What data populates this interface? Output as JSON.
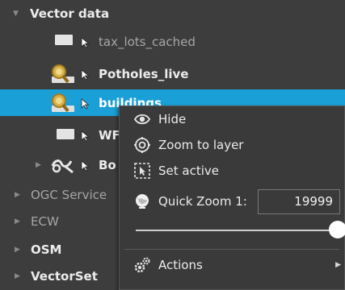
{
  "tree": {
    "items": [
      {
        "label": "Vector data",
        "expander": "expanded",
        "icon": "folder"
      },
      {
        "label": "tax_lots_cached",
        "icon": "raster-layer-icon",
        "state": "dim"
      },
      {
        "label": "Potholes_live",
        "icon": "search-layer-icon",
        "state": "bold"
      },
      {
        "label": "buildings",
        "icon": "search-layer-icon",
        "state": "selected"
      },
      {
        "label": "WF",
        "icon": "raster-layer-icon",
        "state": "bold"
      },
      {
        "label": "Bo",
        "icon": "vector-group-icon",
        "state": "bold",
        "expander": "collapsed"
      },
      {
        "label": "OGC Service",
        "expander": "collapsed",
        "state": "dim"
      },
      {
        "label": "ECW",
        "expander": "collapsed",
        "state": "dim"
      },
      {
        "label": "OSM",
        "expander": "collapsed",
        "state": "bold"
      },
      {
        "label": "VectorSet",
        "expander": "collapsed",
        "state": "bold"
      }
    ]
  },
  "context_menu": {
    "hide": {
      "label": "Hide",
      "icon": "eye-icon"
    },
    "zoom_to_layer": {
      "label": "Zoom to layer",
      "icon": "target-icon"
    },
    "set_active": {
      "label": "Set active",
      "icon": "cursor-box-icon"
    },
    "quick_zoom": {
      "label": "Quick Zoom 1:",
      "icon": "globe-icon",
      "value": "19999"
    },
    "slider": {
      "level": 1.0
    },
    "actions": {
      "label": "Actions",
      "icon": "gears-icon"
    }
  },
  "colors": {
    "background": "#3d3d3d",
    "selection": "#1a9fd6",
    "text": "#ececec"
  }
}
